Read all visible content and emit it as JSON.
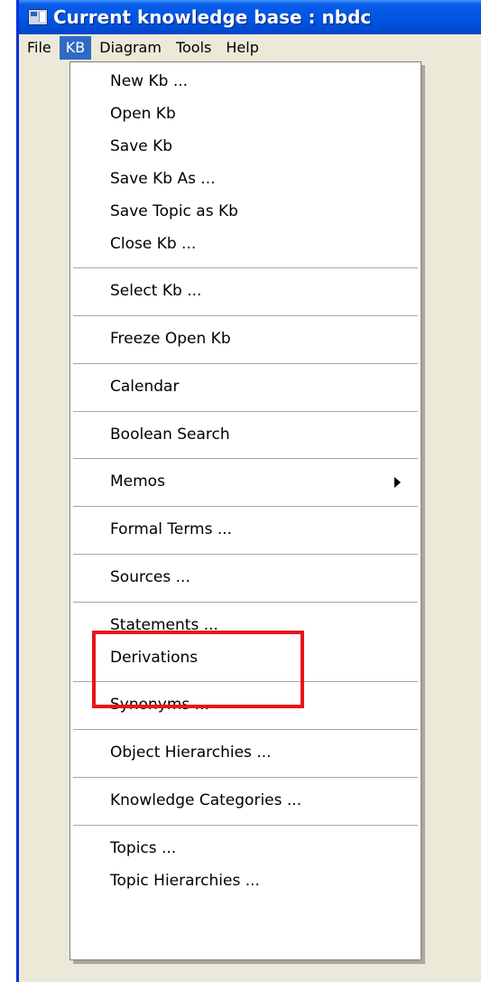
{
  "window": {
    "title": "Current knowledge base : nbdc",
    "icon": "knowledge-base-app-icon"
  },
  "menubar": {
    "items": [
      "File",
      "KB",
      "Diagram",
      "Tools",
      "Help"
    ],
    "active": "KB"
  },
  "kb_menu": {
    "items": [
      "New Kb ...",
      "Open Kb",
      "Save Kb",
      "Save Kb As ...",
      "Save Topic as Kb",
      "Close Kb ...",
      "Select Kb ...",
      "Freeze Open Kb",
      "Calendar",
      "Boolean Search",
      "Memos",
      "Formal Terms ...",
      "Sources ...",
      "Statements ...",
      "Derivations",
      "Synonyms ...",
      "Object Hierarchies ...",
      "Knowledge Categories ...",
      "Topics ...",
      "Topic Hierarchies ..."
    ],
    "submenu_item": "Memos",
    "submenu_indicator": "chevron-right-icon"
  },
  "annotation": {
    "highlight_color": "#e8141b",
    "highlighted_items": [
      "Statements ...",
      "Derivations"
    ]
  },
  "colors": {
    "title_bar": "#0055e5",
    "menu_selection": "#316ac5",
    "window_face": "#ece9d8"
  }
}
